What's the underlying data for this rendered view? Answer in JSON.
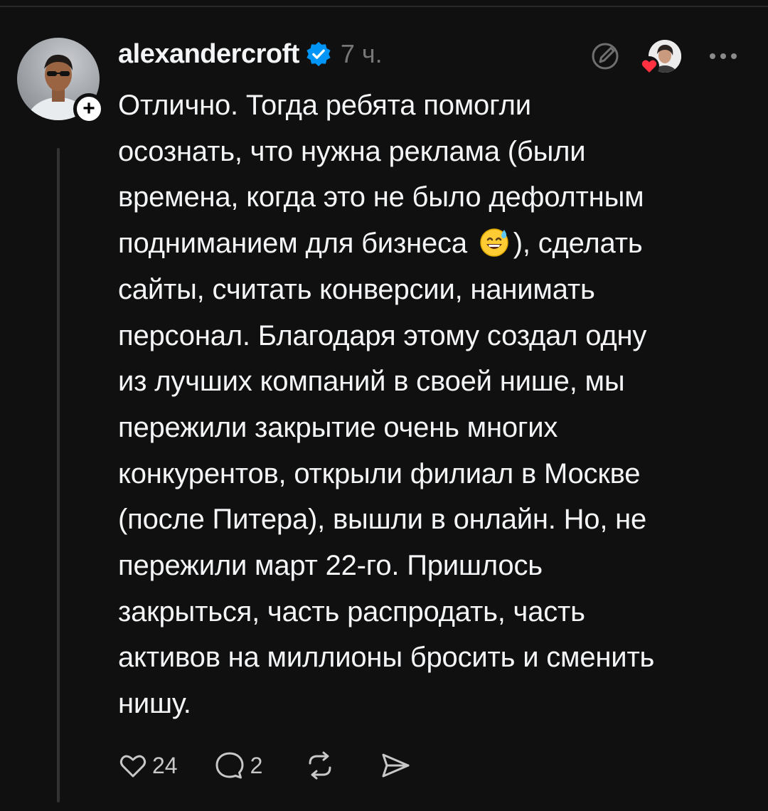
{
  "post": {
    "username": "alexandercroft",
    "timestamp": "7 ч.",
    "text": "Отлично. Тогда ребята помогли\nосознать, что нужна реклама (были\nвремена, когда это не было дефолтным\nподниманием для бизнеса 😅), сделать\nсайты, считать конверсии, нанимать\nперсонал. Благодаря этому создал одну\nиз лучших компаний в своей нише, мы\nпережили закрытие очень многих\nконкурентов, открыли филиал в Москве\n(после Питера), вышли в онлайн. Но, не\nпережили март 22-го. Пришлось\nзакрыться, часть распродать, часть\nактивов на миллионы бросить и сменить\nнишу.",
    "text_before_emoji": "Отлично. Тогда ребята помогли\nосознать, что нужна реклама (были\nвремена, когда это не было дефолтным\nподниманием для бизнеса ",
    "text_after_emoji": "), сделать\nсайты, считать конверсии, нанимать\nперсонал. Благодаря этому создал одну\nиз лучших компаний в своей нише, мы\nпережили закрытие очень многих\nконкурентов, открыли филиал в Москве\n(после Питера), вышли в онлайн. Но, не\nпережили март 22-го. Пришлось\nзакрыться, часть распродать, часть\nактивов на миллионы бросить и сменить\nнишу.",
    "likes": "24",
    "replies": "2"
  },
  "icons": {
    "verified": "verified-badge-icon",
    "edit": "edit-icon",
    "heart_reaction": "heart-icon",
    "more": "more-icon",
    "like": "heart-outline-icon",
    "reply": "comment-icon",
    "repost": "repost-icon",
    "share": "send-icon",
    "follow": "plus-icon"
  },
  "colors": {
    "background": "#101010",
    "text": "#f3f5f7",
    "muted": "#777777",
    "verified": "#0095f6",
    "heart": "#ff3040"
  }
}
